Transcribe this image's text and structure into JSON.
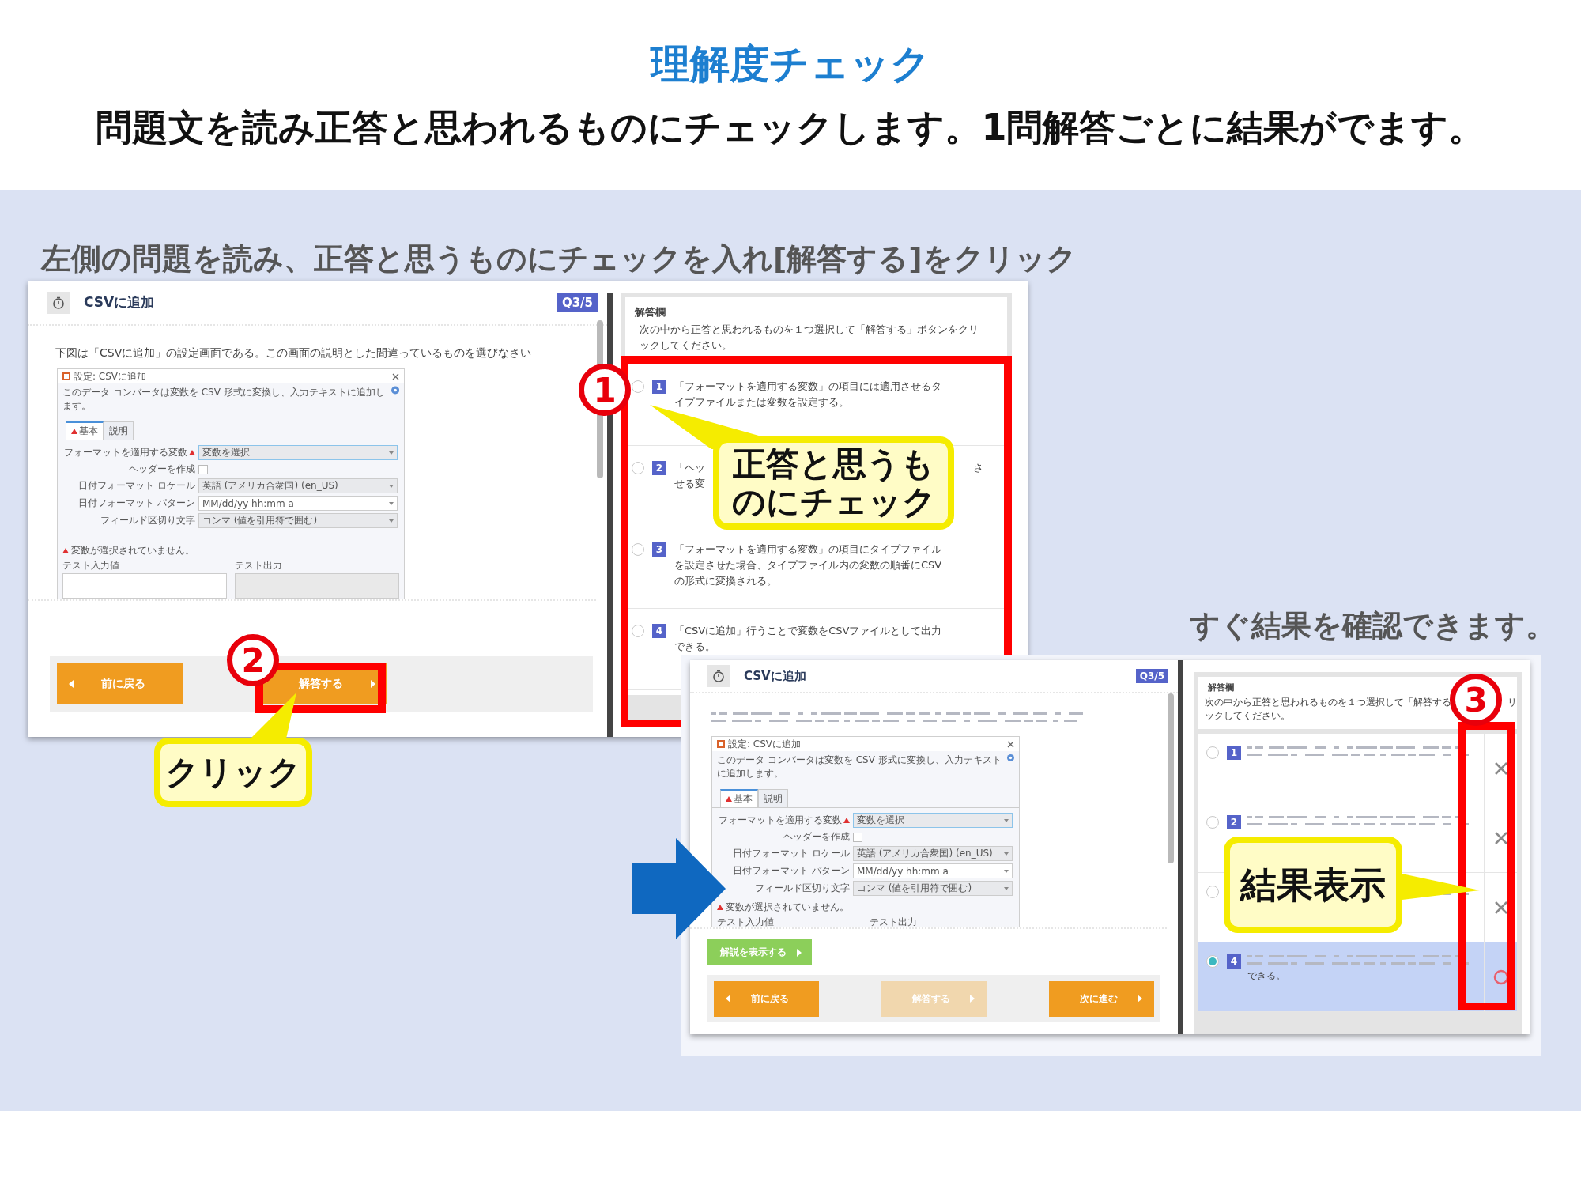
{
  "title": "理解度チェック",
  "subtitle": "問題文を読み正答と思われるものにチェックします。1問解答ごとに結果がでます。",
  "instructions": [
    {
      "text": "左側の問題を読み、正答と思うものにチェックを入れ[解答する]をクリック"
    },
    {
      "text": "すぐ結果を確認できます。"
    }
  ],
  "before_window": {
    "header_title": "CSVに追加",
    "badge": "Q3/5",
    "question": "下図は「CSVに追加」の設定画面である。この画面の説明とした間違っているものを選びなさい",
    "dialog": {
      "title": "設定: CSVに追加",
      "description": "このデータ コンバータは変数を CSV 形式に変換し、入力テキストに追加します。",
      "tabs": [
        {
          "label": "基本",
          "selected": true,
          "warning": true
        },
        {
          "label": "説明",
          "selected": false,
          "warning": false
        }
      ],
      "fields": [
        {
          "label": "フォーマットを適用する変数",
          "kind": "select",
          "value": "変数を選択",
          "required": true,
          "focused": true
        },
        {
          "label": "ヘッダーを作成",
          "kind": "checkbox",
          "checked": false
        },
        {
          "label": "日付フォーマット ロケール",
          "kind": "select",
          "value": "英語 (アメリカ合衆国) (en_US)",
          "focused": false
        },
        {
          "label": "日付フォーマット パターン",
          "kind": "combo",
          "value": "MM/dd/yy hh:mm a",
          "focused": false
        },
        {
          "label": "フィールド区切り文字",
          "kind": "select",
          "value": "コンマ (値を引用符で囲む)",
          "focused": false
        }
      ],
      "warning": "変数が選択されていません。",
      "test_input_label": "テスト入力値",
      "test_output_label": "テスト出力"
    },
    "buttons": [
      {
        "label": "前に戻る",
        "kind": "back",
        "disabled": false
      },
      {
        "label": "解答する",
        "kind": "forward",
        "disabled": false
      }
    ],
    "answer_panel": {
      "heading": "解答欄",
      "description_lines": [
        {
          "start": "次の中から正答と思われるものを１つ選択して「解答する」ボタンをクリ"
        },
        {
          "start": "ックしてください。"
        }
      ],
      "options": [
        {
          "number": "1",
          "selected": false,
          "lines": [
            {
              "start": "「フォーマットを適用する変数」の項目には適用させるタ"
            },
            {
              "start": "イプファイルまたは変数を設定する。"
            }
          ]
        },
        {
          "number": "2",
          "selected": false,
          "lines": [
            {
              "start": "「ヘッ",
              "end": "さ"
            },
            {
              "start": "せる変"
            }
          ]
        },
        {
          "number": "3",
          "selected": false,
          "lines": [
            {
              "start": "「フォーマットを適用する変数」の項目にタイプファイル"
            },
            {
              "start": "を設定させた場合、タイプファイル内の変数の順番にCSV"
            },
            {
              "start": "の形式に変換される。"
            }
          ]
        },
        {
          "number": "4",
          "selected": false,
          "lines": [
            {
              "start": "「CSVに追加」行うことで変数をCSVファイルとして出力"
            },
            {
              "start": "できる。"
            }
          ]
        }
      ]
    }
  },
  "after_window": {
    "header_title": "CSVに追加",
    "badge": "Q3/5",
    "dialog": {
      "title": "設定: CSVに追加",
      "description": "このデータ コンバータは変数を CSV 形式に変換し、入力テキストに追加します。",
      "tabs": [
        {
          "label": "基本",
          "selected": true,
          "warning": true
        },
        {
          "label": "説明",
          "selected": false,
          "warning": false
        }
      ],
      "fields": [
        {
          "label": "フォーマットを適用する変数",
          "kind": "select",
          "value": "変数を選択",
          "required": true,
          "focused": true
        },
        {
          "label": "ヘッダーを作成",
          "kind": "checkbox",
          "checked": false
        },
        {
          "label": "日付フォーマット ロケール",
          "kind": "select",
          "value": "英語 (アメリカ合衆国) (en_US)",
          "focused": false
        },
        {
          "label": "日付フォーマット パターン",
          "kind": "combo",
          "value": "MM/dd/yy hh:mm a",
          "focused": false
        },
        {
          "label": "フィールド区切り文字",
          "kind": "select",
          "value": "コンマ (値を引用符で囲む)",
          "focused": false
        }
      ],
      "warning": "変数が選択されていません。",
      "test_input_label": "テスト入力値",
      "test_output_label": "テスト出力"
    },
    "explain_button": {
      "label": "解説を表示する"
    },
    "buttons": [
      {
        "label": "前に戻る",
        "kind": "back",
        "disabled": false
      },
      {
        "label": "解答する",
        "kind": "forward",
        "disabled": true
      },
      {
        "label": "次に進む",
        "kind": "forward",
        "disabled": false
      }
    ],
    "answer_panel": {
      "heading": "解答欄",
      "description_lines": [
        {
          "start": "次の中から正答と思われるものを１つ選択して「解答する",
          "end": "リ"
        },
        {
          "start": "ックしてください。"
        }
      ],
      "options": [
        {
          "number": "1",
          "selected": false,
          "kind": "wrong"
        },
        {
          "number": "2",
          "selected": false,
          "kind": "wrong"
        },
        {
          "selected": false,
          "kind": "wrong"
        },
        {
          "number": "4",
          "selected": true,
          "kind": "correct",
          "lines": [
            {
              "start": "できる。"
            }
          ]
        }
      ]
    }
  },
  "markers": [
    {
      "label": "1"
    },
    {
      "label": "2"
    },
    {
      "label": "3"
    }
  ],
  "callouts": [
    {
      "text": "正答と思うものにチェック"
    },
    {
      "text": "クリック"
    },
    {
      "text": "結果表示"
    }
  ]
}
